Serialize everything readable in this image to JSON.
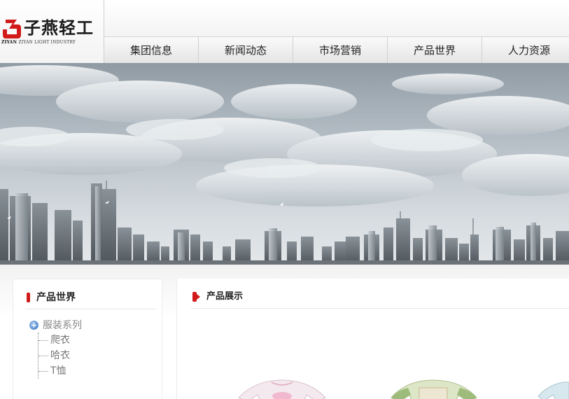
{
  "logo": {
    "name_cn": "子燕轻工",
    "name_en_bold": "ZIYAN",
    "name_en": " ZIYAN LIGHT INDUSTRY",
    "brand_color": "#d11a1a"
  },
  "nav": {
    "items": [
      {
        "label": "集团信息"
      },
      {
        "label": "新闻动态"
      },
      {
        "label": "市场营销"
      },
      {
        "label": "产品世界"
      },
      {
        "label": "人力资源"
      }
    ]
  },
  "banner": {
    "subject": "city-skyline-with-clouds"
  },
  "sidebar": {
    "title": "产品世界",
    "title_icon": "red-bar-icon",
    "tree": {
      "root_label": "服装系列",
      "root_icon": "plus-circle-icon",
      "children": [
        {
          "label": "爬衣"
        },
        {
          "label": "哈衣"
        },
        {
          "label": "T恤"
        }
      ]
    }
  },
  "main": {
    "title": "产品展示",
    "title_icon": "red-arrow-icon",
    "products": [
      {
        "name": "pink-baby-top"
      },
      {
        "name": "green-baby-top"
      },
      {
        "name": "blue-baby-top"
      }
    ]
  }
}
